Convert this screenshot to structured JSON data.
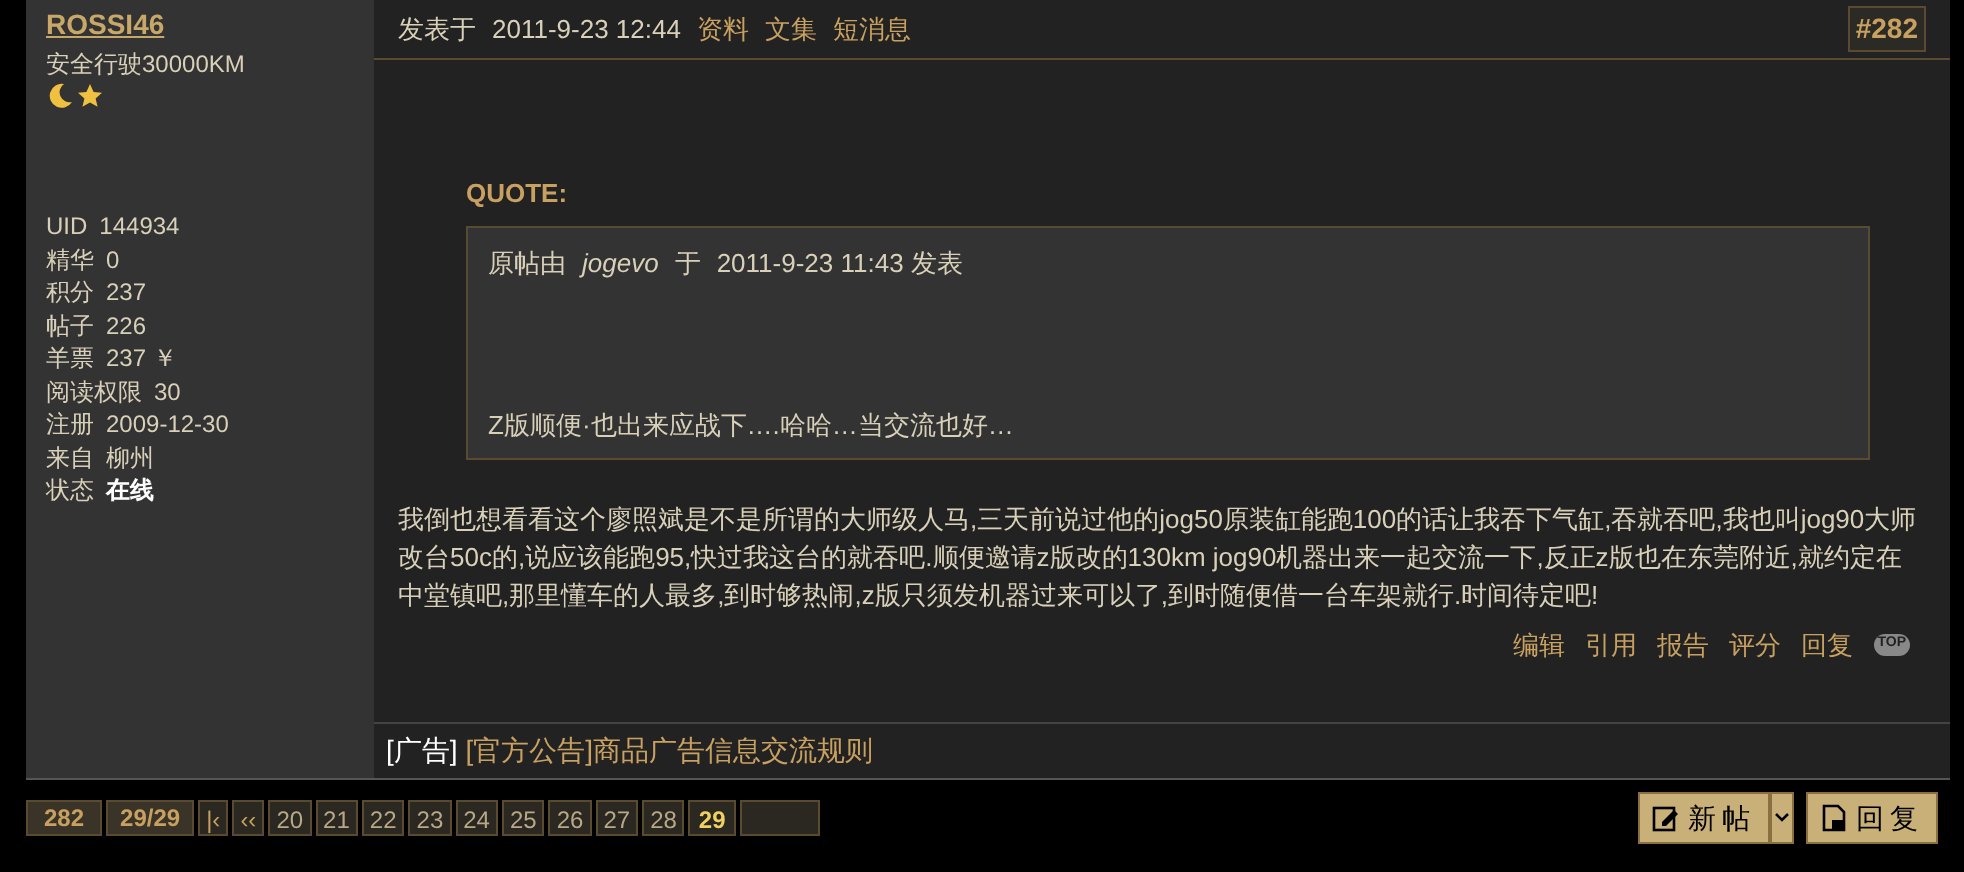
{
  "author": {
    "name": "ROSSI46",
    "rank": "安全行驶30000KM",
    "rank_icons": [
      {
        "kind": "moon"
      },
      {
        "kind": "star"
      }
    ],
    "stats": [
      {
        "label": "UID",
        "value": "144934",
        "bold": false
      },
      {
        "label": "精华",
        "value": "0",
        "bold": false
      },
      {
        "label": "积分",
        "value": "237",
        "bold": false
      },
      {
        "label": "帖子",
        "value": "226",
        "bold": false
      },
      {
        "label": "羊票",
        "value": "237 ￥",
        "bold": false
      },
      {
        "label": "阅读权限",
        "value": "30",
        "bold": false
      },
      {
        "label": "注册",
        "value": "2009-12-30",
        "bold": false
      },
      {
        "label": "来自",
        "value": "柳州",
        "bold": false
      },
      {
        "label": "状态",
        "value": "在线",
        "bold": true
      }
    ]
  },
  "post": {
    "posted_label": "发表于",
    "posted_time": "2011-9-23 12:44",
    "links": [
      "资料",
      "文集",
      "短消息"
    ],
    "floor": "#282",
    "quote": {
      "title": "QUOTE:",
      "prefix": "原帖由",
      "author": "jogevo",
      "mid": "于",
      "time": "2011-9-23 11:43 发表",
      "text": "Z版顺便·也出来应战下….哈哈…当交流也好…"
    },
    "body": "我倒也想看看这个廖照斌是不是所谓的大师级人马,三天前说过他的jog50原装缸能跑100的话让我吞下气缸,吞就吞吧,我也叫jog90大师改台50c的,说应该能跑95,快过我这台的就吞吧.顺便邀请z版改的130km jog90机器出来一起交流一下,反正z版也在东莞附近,就约定在中堂镇吧,那里懂车的人最多,到时够热闹,z版只须发机器过来可以了,到时随便借一台车架就行.时间待定吧!",
    "actions": [
      "编辑",
      "引用",
      "报告",
      "评分",
      "回复"
    ],
    "top_label": "TOP"
  },
  "ad": {
    "tag": "[广告]",
    "link": "[官方公告]商品广告信息交流规则"
  },
  "pager": {
    "total": "282",
    "pages": "29/29",
    "first": "|‹",
    "prev": "‹‹",
    "items": [
      {
        "label": "20",
        "selected": false
      },
      {
        "label": "21",
        "selected": false
      },
      {
        "label": "22",
        "selected": false
      },
      {
        "label": "23",
        "selected": false
      },
      {
        "label": "24",
        "selected": false
      },
      {
        "label": "25",
        "selected": false
      },
      {
        "label": "26",
        "selected": false
      },
      {
        "label": "27",
        "selected": false
      },
      {
        "label": "28",
        "selected": false
      },
      {
        "label": "29",
        "selected": true
      }
    ]
  },
  "buttons": {
    "new": "新帖",
    "reply": "回复"
  }
}
